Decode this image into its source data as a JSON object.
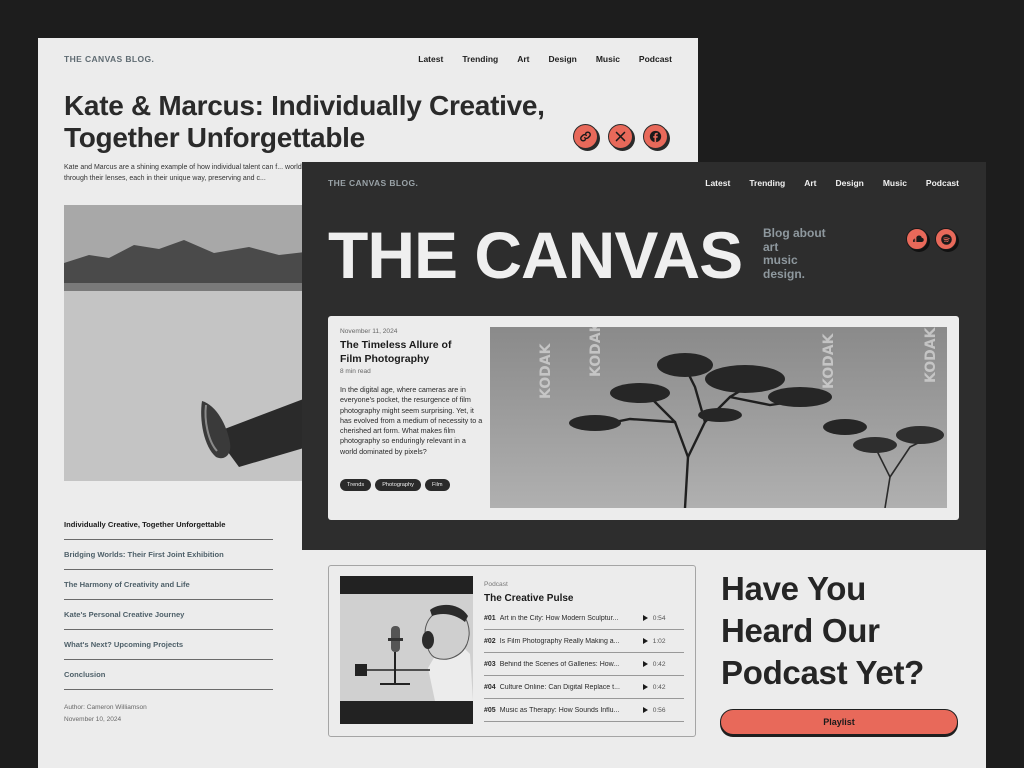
{
  "back": {
    "brand": "THE CANVAS BLOG.",
    "nav": [
      "Latest",
      "Trending",
      "Art",
      "Design",
      "Music",
      "Podcast"
    ],
    "title": "Kate & Marcus: Individually Creative, Together Unforgettable",
    "intro": "Kate and Marcus are a shining example of how individual talent can f... world through their lenses, each in their unique way, preserving and c...",
    "social_icons": [
      "link-icon",
      "x-icon",
      "facebook-icon"
    ],
    "toc": [
      "Individually Creative, Together Unforgettable",
      "Bridging Worlds: Their First Joint Exhibition",
      "The Harmony of Creativity and Life",
      "Kate's Personal Creative Journey",
      "What's Next? Upcoming Projects",
      "Conclusion"
    ],
    "author": "Author: Cameron Williamson",
    "date": "November 10, 2024"
  },
  "front": {
    "brand": "THE CANVAS BLOG.",
    "nav": [
      "Latest",
      "Trending",
      "Art",
      "Design",
      "Music",
      "Podcast"
    ],
    "site_title": "THE CANVAS",
    "tagline": [
      "Blog about",
      "art",
      "music",
      "design."
    ],
    "social_icons": [
      "soundcloud-icon",
      "spotify-icon"
    ],
    "feature": {
      "date": "November 11, 2024",
      "title": "The Timeless Allure of Film Photography",
      "read_time": "8 min read",
      "text": "In the digital age, where cameras are in everyone's pocket, the resurgence of film photography might seem surprising. Yet, it has evolved from a medium of necessity to a cherished art form. What makes film photography so enduringly relevant in a world dominated by pixels?",
      "tags": [
        "Trends",
        "Photography",
        "Film"
      ],
      "film_marks": [
        "KODAK",
        "KODAK",
        "KODAK",
        "KODAK"
      ]
    },
    "podcast": {
      "label": "Podcast",
      "title": "The Creative Pulse",
      "episodes": [
        {
          "num": "#01",
          "title": "Art in the City: How Modern Sculptur...",
          "duration": "0:54"
        },
        {
          "num": "#02",
          "title": "Is Film Photography Really Making a...",
          "duration": "1:02"
        },
        {
          "num": "#03",
          "title": "Behind the Scenes of Galleries: How...",
          "duration": "0:42"
        },
        {
          "num": "#04",
          "title": "Culture Online: Can Digital Replace t...",
          "duration": "0:42"
        },
        {
          "num": "#05",
          "title": "Music as Therapy: How Sounds Influ...",
          "duration": "0:56"
        }
      ],
      "heading": "Have You Heard Our Podcast Yet?",
      "button": "Playlist"
    }
  },
  "colors": {
    "accent": "#e8695a",
    "dark": "#2d2d2d",
    "light": "#ececec",
    "background": "#1d1d1d"
  }
}
